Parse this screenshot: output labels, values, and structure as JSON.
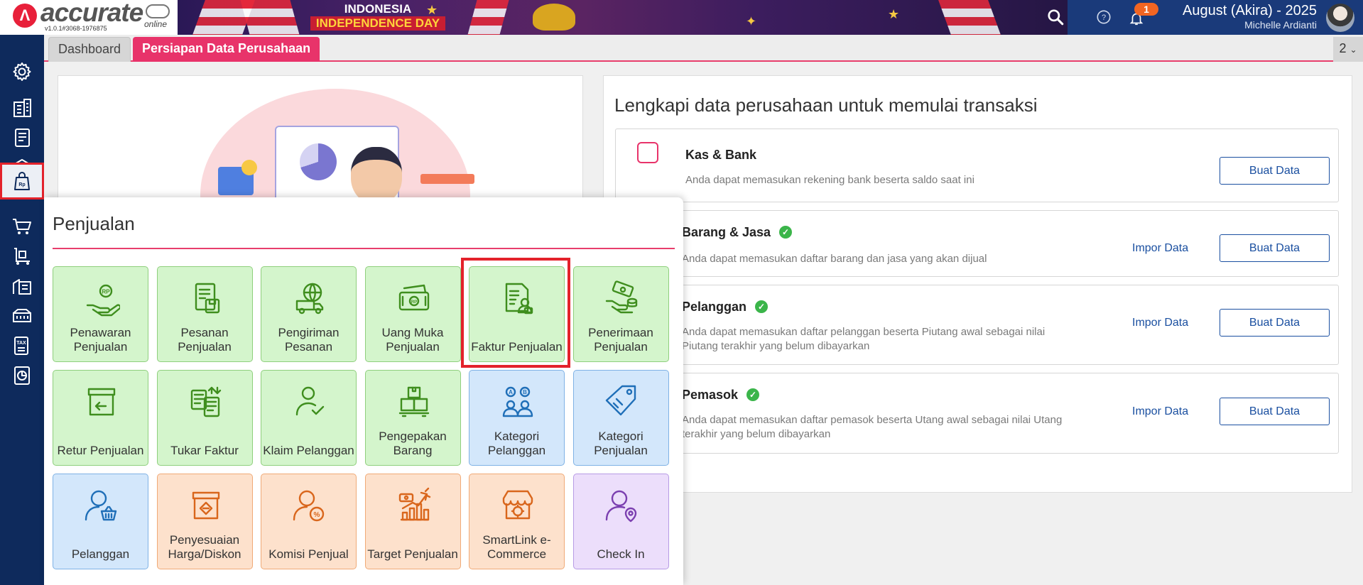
{
  "app": {
    "brand": "accurate",
    "online": "online",
    "version": "v1.0.1#3068-1976875"
  },
  "banner": {
    "line1": "INDONESIA",
    "line2": "INDEPENDENCE DAY"
  },
  "user": {
    "notification_count": "1",
    "name": "August (Akira) - 2025",
    "subtitle": "Michelle Ardianti"
  },
  "sidebar": {
    "items": [
      {
        "icon": "gear-icon"
      },
      {
        "icon": "building-icon"
      },
      {
        "icon": "ledger-book-icon"
      },
      {
        "icon": "bank-icon"
      },
      {
        "icon": "sales-bag-icon",
        "active": true
      },
      {
        "icon": "cart-icon"
      },
      {
        "icon": "trolley-icon"
      },
      {
        "icon": "warehouse-icon"
      },
      {
        "icon": "factory-icon"
      },
      {
        "icon": "tax-document-icon"
      },
      {
        "icon": "report-chart-icon"
      }
    ]
  },
  "tabs": {
    "dashboard": "Dashboard",
    "setup": "Persiapan Data Perusahaan",
    "count": "2"
  },
  "setup_panel": {
    "title": "Lengkapi data perusahaan untuk memulai transaksi",
    "cards": [
      {
        "title": "Kas & Bank",
        "desc": "Anda dapat memasukan rekening bank beserta saldo saat ini",
        "done": false,
        "import": "",
        "create": "Buat Data"
      },
      {
        "title": "Barang & Jasa",
        "desc": "Anda dapat memasukan daftar barang dan jasa yang akan dijual",
        "done": true,
        "import": "Impor Data",
        "create": "Buat Data"
      },
      {
        "title": "Pelanggan",
        "desc": "Anda dapat memasukan daftar pelanggan beserta Piutang awal sebagai nilai Piutang terakhir yang belum dibayarkan",
        "done": true,
        "import": "Impor Data",
        "create": "Buat Data"
      },
      {
        "title": "Pemasok",
        "desc": "Anda dapat memasukan daftar pemasok beserta Utang awal sebagai nilai Utang terakhir yang belum dibayarkan",
        "done": true,
        "import": "Impor Data",
        "create": "Buat Data"
      }
    ]
  },
  "menu": {
    "title": "Penjualan",
    "tiles": [
      {
        "label": "Penawaran Penjualan",
        "color": "green",
        "icon": "hand-coin-icon"
      },
      {
        "label": "Pesanan Penjualan",
        "color": "green",
        "icon": "order-document-icon"
      },
      {
        "label": "Pengiriman Pesanan",
        "color": "green",
        "icon": "delivery-truck-globe-icon"
      },
      {
        "label": "Uang Muka Penjualan",
        "color": "green",
        "icon": "cash-money-icon"
      },
      {
        "label": "Faktur Penjualan",
        "color": "green",
        "icon": "invoice-user-icon"
      },
      {
        "label": "Penerimaan Penjualan",
        "color": "green",
        "icon": "hand-receive-money-icon"
      },
      {
        "label": "Retur Penjualan",
        "color": "green",
        "icon": "return-box-icon"
      },
      {
        "label": "Tukar Faktur",
        "color": "green",
        "icon": "exchange-invoice-icon"
      },
      {
        "label": "Klaim Pelanggan",
        "color": "green",
        "icon": "user-check-icon"
      },
      {
        "label": "Pengepakan Barang",
        "color": "green",
        "icon": "packing-box-icon"
      },
      {
        "label": "Kategori Pelanggan",
        "color": "blue",
        "icon": "customer-category-icon"
      },
      {
        "label": "Kategori Penjualan",
        "color": "blue",
        "icon": "sales-tag-icon"
      },
      {
        "label": "Pelanggan",
        "color": "blue",
        "icon": "customer-basket-icon"
      },
      {
        "label": "Penyesuaian Harga/Diskon",
        "color": "orange",
        "icon": "price-adjust-icon"
      },
      {
        "label": "Komisi Penjual",
        "color": "orange",
        "icon": "commission-user-icon"
      },
      {
        "label": "Target Penjualan",
        "color": "orange",
        "icon": "target-chart-icon"
      },
      {
        "label": "SmartLink e-Commerce",
        "color": "orange",
        "icon": "ecommerce-store-icon"
      },
      {
        "label": "Check In",
        "color": "purple",
        "icon": "user-location-icon"
      }
    ],
    "colors": {
      "green": "#d4f5cc",
      "blue": "#d3e7fb",
      "orange": "#fde1cc",
      "purple": "#ecdefb"
    },
    "icon_colors": {
      "green": "#3f8e1e",
      "blue": "#1f6fb8",
      "orange": "#d9661c",
      "purple": "#7b3fb0"
    }
  }
}
